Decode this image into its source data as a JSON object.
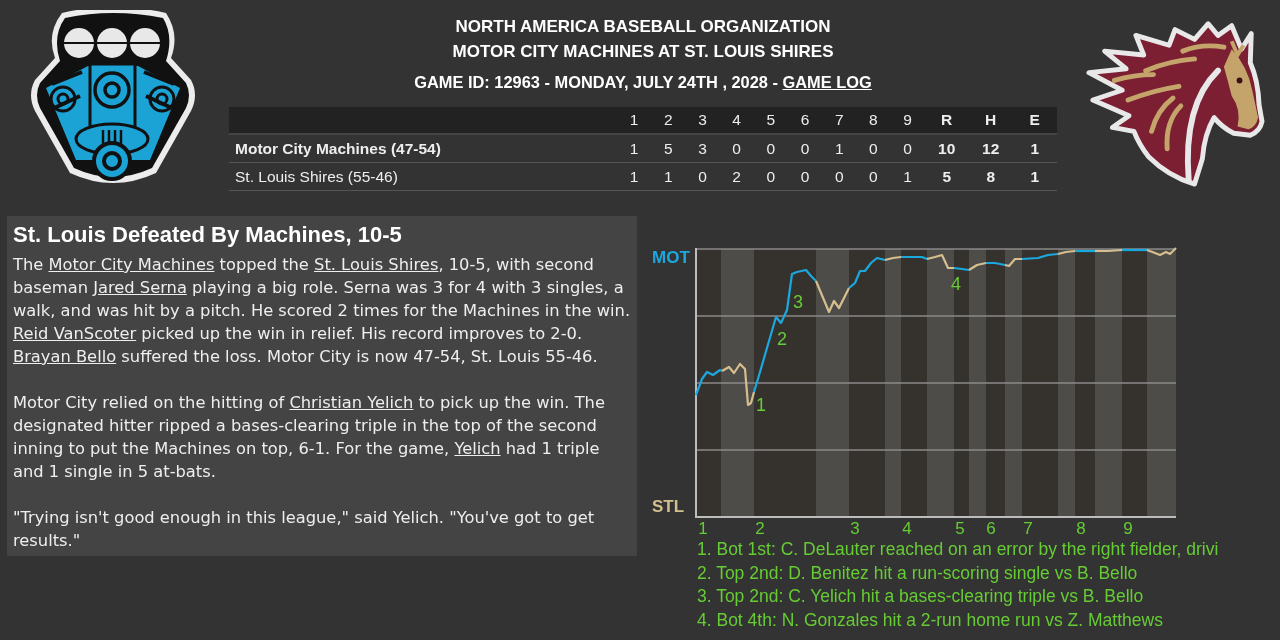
{
  "header": {
    "league": "NORTH AMERICA BASEBALL ORGANIZATION",
    "matchup": "MOTOR CITY MACHINES AT ST. LOUIS SHIRES",
    "game_info": [
      {
        "kind": "text",
        "text": "GAME ID: 12963 - MONDAY, JULY 24TH , 2028 - "
      },
      {
        "kind": "link",
        "text": "GAME LOG"
      }
    ]
  },
  "box_score": {
    "columns": [
      {
        "label": "1",
        "kind": "inning"
      },
      {
        "label": "2",
        "kind": "inning"
      },
      {
        "label": "3",
        "kind": "inning"
      },
      {
        "label": "4",
        "kind": "inning"
      },
      {
        "label": "5",
        "kind": "inning"
      },
      {
        "label": "6",
        "kind": "inning"
      },
      {
        "label": "7",
        "kind": "inning"
      },
      {
        "label": "8",
        "kind": "inning"
      },
      {
        "label": "9",
        "kind": "inning"
      },
      {
        "label": "R",
        "kind": "total"
      },
      {
        "label": "H",
        "kind": "total"
      },
      {
        "label": "E",
        "kind": "total"
      }
    ],
    "rows": [
      {
        "team": "Motor City Machines (47-54)",
        "winner": true,
        "cells": [
          "1",
          "5",
          "3",
          "0",
          "0",
          "0",
          "1",
          "0",
          "0",
          "10",
          "12",
          "1"
        ]
      },
      {
        "team": "St. Louis Shires (55-46)",
        "winner": false,
        "cells": [
          "1",
          "1",
          "0",
          "2",
          "0",
          "0",
          "0",
          "0",
          "1",
          "5",
          "8",
          "1"
        ]
      }
    ]
  },
  "article": {
    "headline": "St. Louis Defeated By Machines, 10-5",
    "paragraphs": [
      [
        {
          "kind": "text",
          "text": "The "
        },
        {
          "kind": "link",
          "text": "Motor City Machines"
        },
        {
          "kind": "text",
          "text": " topped the "
        },
        {
          "kind": "link",
          "text": "St. Louis Shires"
        },
        {
          "kind": "text",
          "text": ", 10-5, with second baseman "
        },
        {
          "kind": "link",
          "text": "Jared Serna"
        },
        {
          "kind": "text",
          "text": " playing a big role. Serna was 3 for 4 with 3 singles, a walk, and was hit by a pitch. He scored 2 times for the Machines in the win. "
        },
        {
          "kind": "link",
          "text": "Reid VanScoter"
        },
        {
          "kind": "text",
          "text": " picked up the win in relief. His record improves to 2-0. "
        },
        {
          "kind": "link",
          "text": "Brayan Bello"
        },
        {
          "kind": "text",
          "text": " suffered the loss. Motor City is now 47-54, St. Louis 55-46."
        }
      ],
      [
        {
          "kind": "text",
          "text": "Motor City relied on the hitting of "
        },
        {
          "kind": "link",
          "text": "Christian Yelich"
        },
        {
          "kind": "text",
          "text": " to pick up the win. The designated hitter ripped a bases-clearing triple in the top of the second inning to put the Machines on top, 6-1. For the game, "
        },
        {
          "kind": "link",
          "text": "Yelich"
        },
        {
          "kind": "text",
          "text": " had 1 triple and 1 single in 5 at-bats."
        }
      ],
      [
        {
          "kind": "text",
          "text": "\"Trying isn't good enough in this league,\" said Yelich. \"You've got to get results.\""
        }
      ]
    ]
  },
  "chart": {
    "teams": [
      {
        "label": "MOT",
        "color": "#1ba8de"
      },
      {
        "label": "STL",
        "color": "#d6bf8e"
      }
    ],
    "innings": [
      "1",
      "2",
      "3",
      "4",
      "5",
      "6",
      "7",
      "8",
      "9"
    ],
    "markers": [
      "1",
      "2",
      "3",
      "4"
    ],
    "notes": [
      "1. Bot 1st: C. DeLauter reached on an error by the right fielder, drivi",
      "2. Top 2nd: D. Benitez hit a run-scoring single vs B. Bello",
      "3. Top 2nd: C. Yelich hit a bases-clearing triple vs B. Bello",
      "4. Bot 4th: N. Gonzales hit a 2-run home run vs Z. Matthews"
    ]
  }
}
